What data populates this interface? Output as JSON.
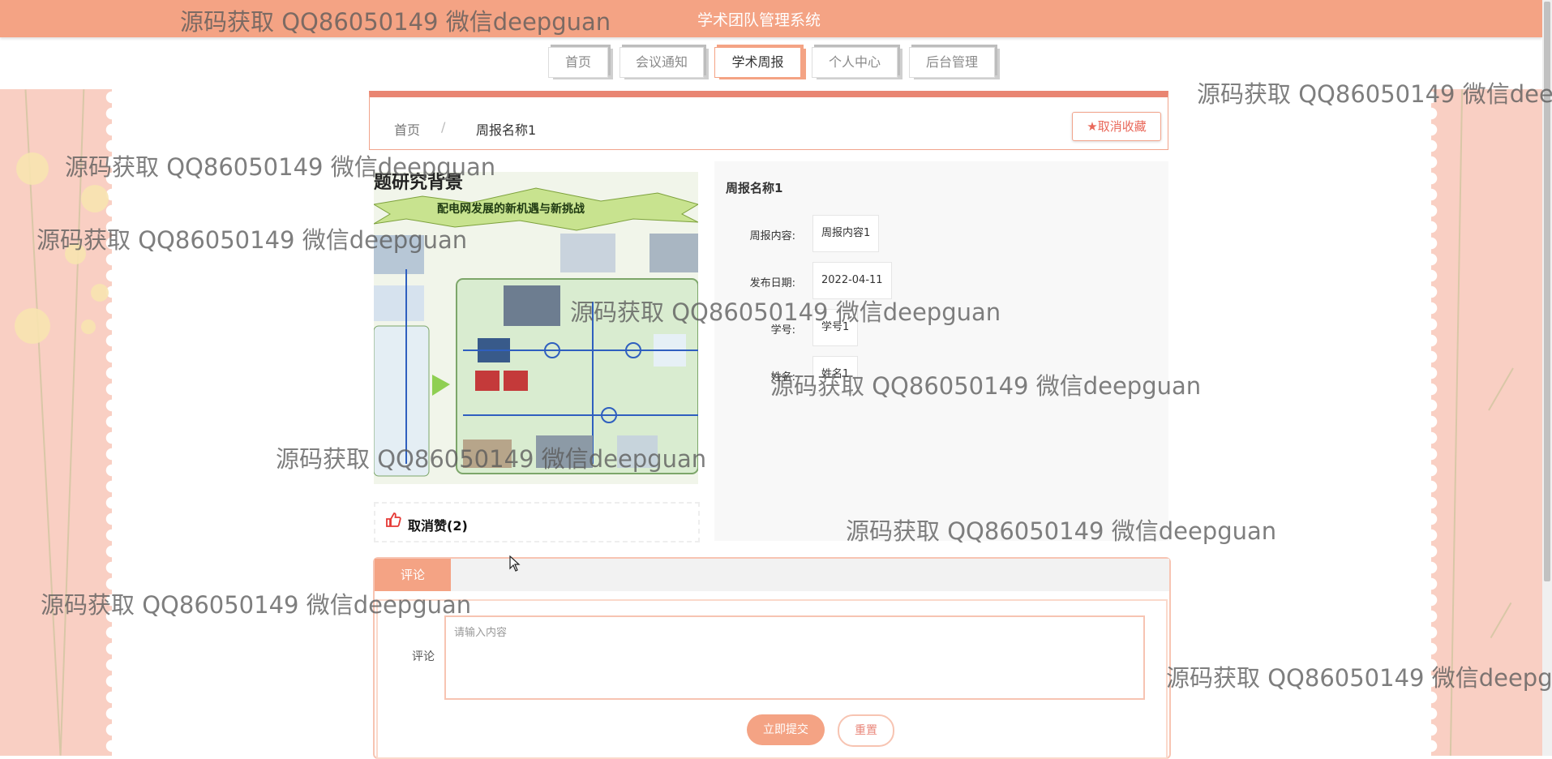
{
  "header": {
    "system_title": "学术团队管理系统"
  },
  "nav": [
    {
      "label": "首页",
      "active": false
    },
    {
      "label": "会议通知",
      "active": false
    },
    {
      "label": "学术周报",
      "active": true
    },
    {
      "label": "个人中心",
      "active": false
    },
    {
      "label": "后台管理",
      "active": false
    }
  ],
  "breadcrumb": {
    "home": "首页",
    "separator": "/",
    "current": "周报名称1"
  },
  "favorite_button": {
    "icon": "star-icon",
    "label": "取消收藏"
  },
  "image": {
    "heading": "题研究背景",
    "banner": "配电网发展的新机遇与新挑战"
  },
  "like": {
    "icon": "thumbs-up-icon",
    "label": "取消赞(2)"
  },
  "detail": {
    "title": "周报名称1",
    "fields": [
      {
        "label": "周报内容:",
        "value": "周报内容1"
      },
      {
        "label": "发布日期:",
        "value": "2022-04-11"
      },
      {
        "label": "学号:",
        "value": "学号1"
      },
      {
        "label": "姓名:",
        "value": "姓名1"
      }
    ]
  },
  "comment": {
    "tab_label": "评论",
    "field_label": "评论",
    "placeholder": "请输入内容",
    "submit_label": "立即提交",
    "reset_label": "重置"
  },
  "watermark": "源码获取 QQ86050149 微信deepguan",
  "colors": {
    "accent": "#f4a384",
    "accent_dark": "#e98572",
    "side_panel": "#f9cfc3"
  }
}
